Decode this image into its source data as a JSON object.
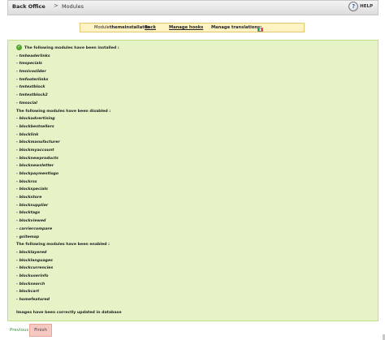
{
  "header": {
    "breadcrumb_home": "Back Office",
    "breadcrumb_separator": ">",
    "breadcrumb_page": "Modules",
    "help_label": "HELP"
  },
  "module_nav": {
    "module_prefix": "Module",
    "module_name": "themeinstallator",
    "back_link": "Back",
    "manage_hooks_link": "Manage hooks",
    "manage_translations_label": "Manage translations:",
    "flags": [
      "en",
      "fr",
      "es",
      "de",
      "it"
    ]
  },
  "result": {
    "installed_heading": "The following modules have been installed :",
    "installed": [
      "tmheaderlinks",
      "tmspecials",
      "tmnivoslider",
      "tmfooterlinks",
      "tmtextblock",
      "tmtextblock2",
      "tmsocial"
    ],
    "disabled_heading": "The following modules have been disabled :",
    "disabled": [
      "blockadvertising",
      "blockbestsellers",
      "blocklink",
      "blockmanufacturer",
      "blockmyaccount",
      "blocknewproducts",
      "blocknewsletter",
      "blockpaymentlogo",
      "blockrss",
      "blockspecials",
      "blockstore",
      "blocksupplier",
      "blocktags",
      "blockviewed",
      "carriercompare",
      "gsitemap"
    ],
    "enabled_heading": "The following modules have been enabled :",
    "enabled": [
      "blocklayered",
      "blocklanguages",
      "blockcurrencies",
      "blockuserinfo",
      "blocksearch",
      "blockcart",
      "homefeatured"
    ],
    "images_message": "Images have been correctly updated in database"
  },
  "buttons": {
    "previous": "Previous",
    "finish": "Finish"
  },
  "colors": {
    "panel_background": "#e5f3c6",
    "nav_background": "#fff3c4",
    "finish_button": "#f5c8c2"
  }
}
